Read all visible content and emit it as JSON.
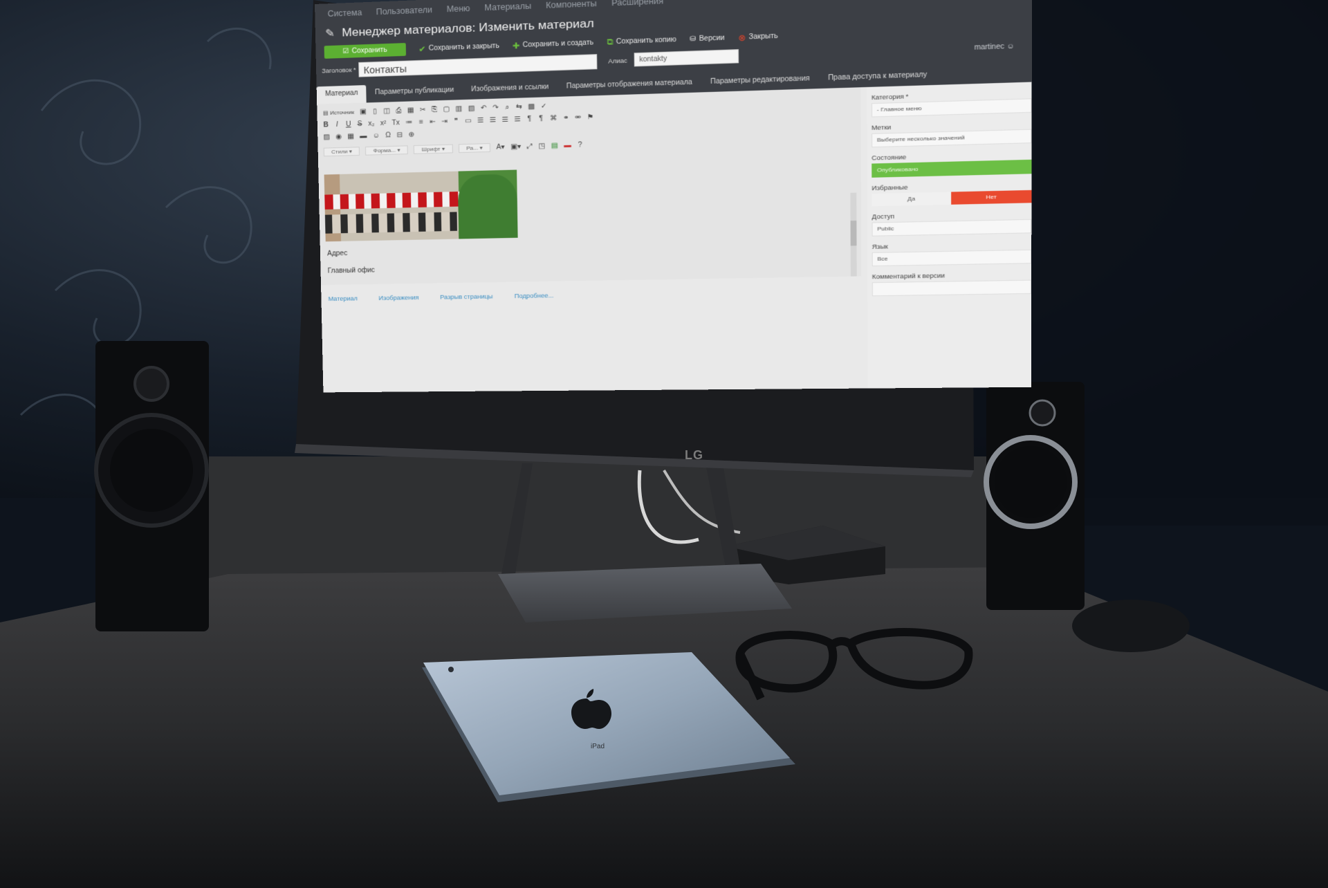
{
  "screen": {
    "menu": [
      "Система",
      "Пользователи",
      "Меню",
      "Материалы",
      "Компоненты",
      "Расширения"
    ],
    "title": "Менеджер материалов: Изменить материал",
    "toolbar": {
      "save": "Сохранить",
      "save_close": "Сохранить и закрыть",
      "save_new": "Сохранить и создать",
      "save_copy": "Сохранить копию",
      "versions": "Версии",
      "close": "Закрыть"
    },
    "user": "martinec",
    "title_label": "Заголовок *",
    "title_value": "Контакты",
    "alias_label": "Алиас",
    "alias_value": "kontakty",
    "tabs": [
      "Материал",
      "Параметры публикации",
      "Изображения и ссылки",
      "Параметры отображения материала",
      "Параметры редактирования",
      "Права доступа к материалу"
    ],
    "editor": {
      "source": "Источник",
      "styles": "Стили",
      "format": "Форма...",
      "font": "Шрифт",
      "size": "Ра...",
      "paragraphs": [
        "Адрес",
        "Главный офис"
      ],
      "buttons": [
        "Материал",
        "Изображения",
        "Разрыв страницы",
        "Подробнее..."
      ]
    },
    "sidebar": {
      "category_label": "Категория *",
      "category_value": "- Главное меню",
      "tags_label": "Метки",
      "tags_placeholder": "Выберите несколько значений",
      "status_label": "Состояние",
      "status_value": "Опубликовано",
      "featured_label": "Избранные",
      "featured_yes": "Да",
      "featured_no": "Нет",
      "access_label": "Доступ",
      "access_value": "Public",
      "language_label": "Язык",
      "language_value": "Все",
      "version_note_label": "Комментарий к версии"
    }
  },
  "monitor_brand": "LG",
  "tablet_label": "iPad",
  "colors": {
    "save_green": "#5cb032",
    "status_green": "#6cbf45",
    "no_red": "#e94a2f",
    "topbar": "#3c3f45"
  }
}
